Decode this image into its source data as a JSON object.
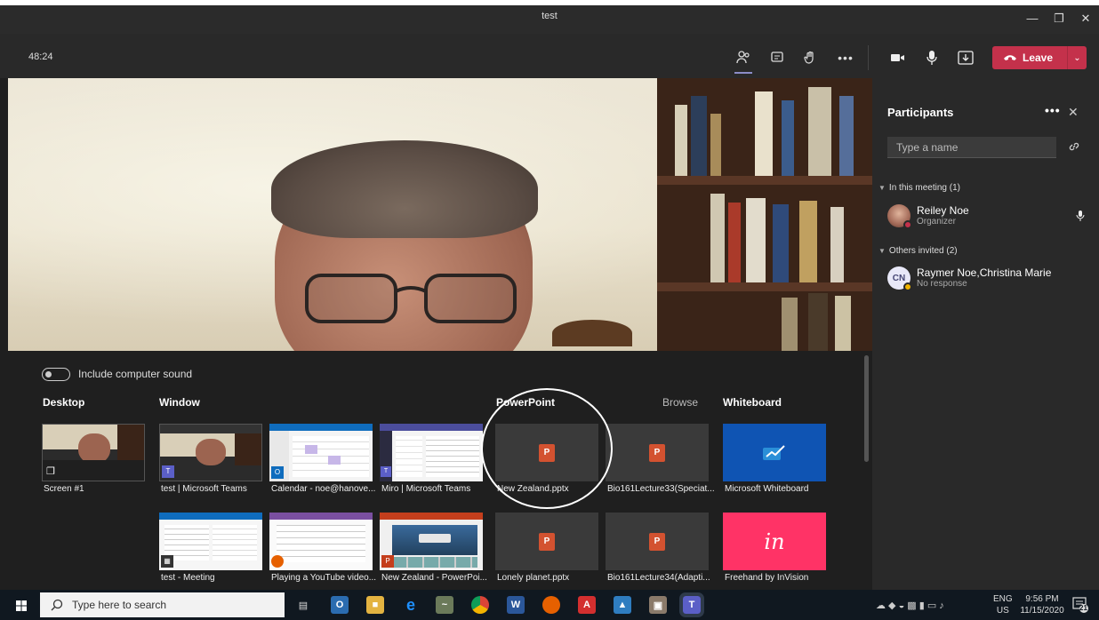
{
  "window": {
    "title": "test"
  },
  "toolbar": {
    "timer": "48:24",
    "leave_label": "Leave"
  },
  "participants": {
    "title": "Participants",
    "search_placeholder": "Type a name",
    "in_meeting_label": "In this meeting (1)",
    "others_label": "Others invited (2)",
    "in_meeting": [
      {
        "name": "Reiley Noe",
        "role": "Organizer"
      }
    ],
    "others": [
      {
        "initials": "CN",
        "name": "Raymer Noe,Christina Marie",
        "status": "No response"
      }
    ]
  },
  "share_tray": {
    "include_sound_label": "Include computer sound",
    "categories": {
      "desktop": "Desktop",
      "window": "Window",
      "powerpoint": "PowerPoint",
      "browse": "Browse",
      "whiteboard": "Whiteboard"
    },
    "desktop_items": [
      "Screen #1"
    ],
    "window_items": [
      "test | Microsoft Teams",
      "Calendar - noe@hanove...",
      "Miro | Microsoft Teams",
      "test - Meeting",
      "Playing a YouTube video...",
      "New Zealand - PowerPoi..."
    ],
    "powerpoint_items": [
      "New Zealand.pptx",
      "Bio161Lecture33(Speciat...",
      "Lonely planet.pptx",
      "Bio161Lecture34(Adapti..."
    ],
    "whiteboard_items": [
      "Microsoft Whiteboard",
      "Freehand by InVision"
    ],
    "invision_logo": "in"
  },
  "taskbar": {
    "search_placeholder": "Type here to search",
    "lang_top": "ENG",
    "lang_bottom": "US",
    "time": "9:56 PM",
    "date": "11/15/2020",
    "notification_count": "21"
  }
}
